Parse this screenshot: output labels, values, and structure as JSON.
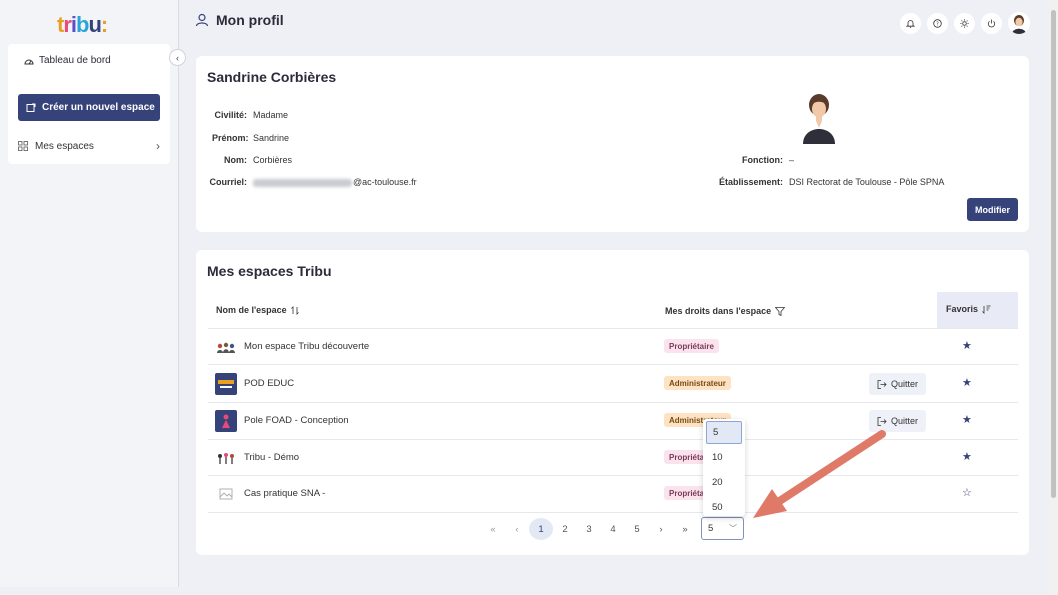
{
  "logo": {
    "text": "tribu:",
    "colors": [
      "#e8a020",
      "#e84a7a",
      "#5a4fcf",
      "#2aa5d8",
      "#36427a",
      "#e8a020"
    ]
  },
  "sidebar": {
    "dashboard_label": "Tableau de bord",
    "create_label": "Créer un nouvel espace",
    "my_spaces_label": "Mes espaces"
  },
  "header": {
    "title": "Mon profil",
    "icons": [
      "bell-icon",
      "help-icon",
      "sun-icon",
      "power-icon"
    ]
  },
  "profile": {
    "name": "Sandrine Corbières",
    "civilite_label": "Civilité:",
    "civilite": "Madame",
    "prenom_label": "Prénom:",
    "prenom": "Sandrine",
    "nom_label": "Nom:",
    "nom": "Corbières",
    "courriel_label": "Courriel:",
    "courriel_domain": "@ac-toulouse.fr",
    "fonction_label": "Fonction:",
    "fonction": "–",
    "etablissement_label": "Établissement:",
    "etablissement": "DSI Rectorat de Toulouse - Pôle SPNA",
    "modify_label": "Modifier"
  },
  "spaces": {
    "title": "Mes espaces Tribu",
    "col_name": "Nom de l'espace",
    "col_rights": "Mes droits dans l'espace",
    "col_fav": "Favoris",
    "quit_label": "Quitter",
    "rows": [
      {
        "name": "Mon espace Tribu découverte",
        "role": "Propriétaire",
        "role_type": "owner",
        "quit": false,
        "fav": true
      },
      {
        "name": "POD EDUC",
        "role": "Administrateur",
        "role_type": "admin",
        "quit": true,
        "fav": true
      },
      {
        "name": "Pole FOAD - Conception",
        "role": "Administrateur",
        "role_type": "admin",
        "quit": true,
        "fav": true
      },
      {
        "name": "Tribu - Démo",
        "role": "Propriétaire",
        "role_type": "owner",
        "quit": false,
        "fav": true
      },
      {
        "name": "Cas pratique SNA -",
        "role": "Propriétaire",
        "role_type": "owner",
        "quit": false,
        "fav": false
      }
    ]
  },
  "pagination": {
    "first": "«",
    "prev": "‹",
    "pages": [
      "1",
      "2",
      "3",
      "4",
      "5"
    ],
    "active_page": "1",
    "next": "›",
    "last": "»",
    "page_size": "5",
    "page_size_options": [
      "5",
      "10",
      "20",
      "50"
    ]
  }
}
